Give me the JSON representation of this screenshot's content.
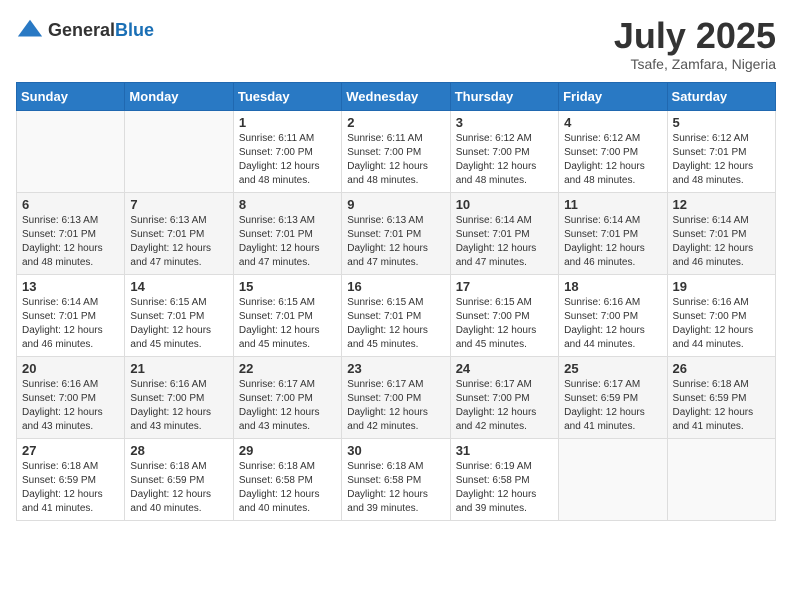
{
  "logo": {
    "general": "General",
    "blue": "Blue"
  },
  "title": {
    "month_year": "July 2025",
    "location": "Tsafe, Zamfara, Nigeria"
  },
  "headers": [
    "Sunday",
    "Monday",
    "Tuesday",
    "Wednesday",
    "Thursday",
    "Friday",
    "Saturday"
  ],
  "weeks": [
    [
      {
        "day": "",
        "sunrise": "",
        "sunset": "",
        "daylight": ""
      },
      {
        "day": "",
        "sunrise": "",
        "sunset": "",
        "daylight": ""
      },
      {
        "day": "1",
        "sunrise": "Sunrise: 6:11 AM",
        "sunset": "Sunset: 7:00 PM",
        "daylight": "Daylight: 12 hours and 48 minutes."
      },
      {
        "day": "2",
        "sunrise": "Sunrise: 6:11 AM",
        "sunset": "Sunset: 7:00 PM",
        "daylight": "Daylight: 12 hours and 48 minutes."
      },
      {
        "day": "3",
        "sunrise": "Sunrise: 6:12 AM",
        "sunset": "Sunset: 7:00 PM",
        "daylight": "Daylight: 12 hours and 48 minutes."
      },
      {
        "day": "4",
        "sunrise": "Sunrise: 6:12 AM",
        "sunset": "Sunset: 7:00 PM",
        "daylight": "Daylight: 12 hours and 48 minutes."
      },
      {
        "day": "5",
        "sunrise": "Sunrise: 6:12 AM",
        "sunset": "Sunset: 7:01 PM",
        "daylight": "Daylight: 12 hours and 48 minutes."
      }
    ],
    [
      {
        "day": "6",
        "sunrise": "Sunrise: 6:13 AM",
        "sunset": "Sunset: 7:01 PM",
        "daylight": "Daylight: 12 hours and 48 minutes."
      },
      {
        "day": "7",
        "sunrise": "Sunrise: 6:13 AM",
        "sunset": "Sunset: 7:01 PM",
        "daylight": "Daylight: 12 hours and 47 minutes."
      },
      {
        "day": "8",
        "sunrise": "Sunrise: 6:13 AM",
        "sunset": "Sunset: 7:01 PM",
        "daylight": "Daylight: 12 hours and 47 minutes."
      },
      {
        "day": "9",
        "sunrise": "Sunrise: 6:13 AM",
        "sunset": "Sunset: 7:01 PM",
        "daylight": "Daylight: 12 hours and 47 minutes."
      },
      {
        "day": "10",
        "sunrise": "Sunrise: 6:14 AM",
        "sunset": "Sunset: 7:01 PM",
        "daylight": "Daylight: 12 hours and 47 minutes."
      },
      {
        "day": "11",
        "sunrise": "Sunrise: 6:14 AM",
        "sunset": "Sunset: 7:01 PM",
        "daylight": "Daylight: 12 hours and 46 minutes."
      },
      {
        "day": "12",
        "sunrise": "Sunrise: 6:14 AM",
        "sunset": "Sunset: 7:01 PM",
        "daylight": "Daylight: 12 hours and 46 minutes."
      }
    ],
    [
      {
        "day": "13",
        "sunrise": "Sunrise: 6:14 AM",
        "sunset": "Sunset: 7:01 PM",
        "daylight": "Daylight: 12 hours and 46 minutes."
      },
      {
        "day": "14",
        "sunrise": "Sunrise: 6:15 AM",
        "sunset": "Sunset: 7:01 PM",
        "daylight": "Daylight: 12 hours and 45 minutes."
      },
      {
        "day": "15",
        "sunrise": "Sunrise: 6:15 AM",
        "sunset": "Sunset: 7:01 PM",
        "daylight": "Daylight: 12 hours and 45 minutes."
      },
      {
        "day": "16",
        "sunrise": "Sunrise: 6:15 AM",
        "sunset": "Sunset: 7:01 PM",
        "daylight": "Daylight: 12 hours and 45 minutes."
      },
      {
        "day": "17",
        "sunrise": "Sunrise: 6:15 AM",
        "sunset": "Sunset: 7:00 PM",
        "daylight": "Daylight: 12 hours and 45 minutes."
      },
      {
        "day": "18",
        "sunrise": "Sunrise: 6:16 AM",
        "sunset": "Sunset: 7:00 PM",
        "daylight": "Daylight: 12 hours and 44 minutes."
      },
      {
        "day": "19",
        "sunrise": "Sunrise: 6:16 AM",
        "sunset": "Sunset: 7:00 PM",
        "daylight": "Daylight: 12 hours and 44 minutes."
      }
    ],
    [
      {
        "day": "20",
        "sunrise": "Sunrise: 6:16 AM",
        "sunset": "Sunset: 7:00 PM",
        "daylight": "Daylight: 12 hours and 43 minutes."
      },
      {
        "day": "21",
        "sunrise": "Sunrise: 6:16 AM",
        "sunset": "Sunset: 7:00 PM",
        "daylight": "Daylight: 12 hours and 43 minutes."
      },
      {
        "day": "22",
        "sunrise": "Sunrise: 6:17 AM",
        "sunset": "Sunset: 7:00 PM",
        "daylight": "Daylight: 12 hours and 43 minutes."
      },
      {
        "day": "23",
        "sunrise": "Sunrise: 6:17 AM",
        "sunset": "Sunset: 7:00 PM",
        "daylight": "Daylight: 12 hours and 42 minutes."
      },
      {
        "day": "24",
        "sunrise": "Sunrise: 6:17 AM",
        "sunset": "Sunset: 7:00 PM",
        "daylight": "Daylight: 12 hours and 42 minutes."
      },
      {
        "day": "25",
        "sunrise": "Sunrise: 6:17 AM",
        "sunset": "Sunset: 6:59 PM",
        "daylight": "Daylight: 12 hours and 41 minutes."
      },
      {
        "day": "26",
        "sunrise": "Sunrise: 6:18 AM",
        "sunset": "Sunset: 6:59 PM",
        "daylight": "Daylight: 12 hours and 41 minutes."
      }
    ],
    [
      {
        "day": "27",
        "sunrise": "Sunrise: 6:18 AM",
        "sunset": "Sunset: 6:59 PM",
        "daylight": "Daylight: 12 hours and 41 minutes."
      },
      {
        "day": "28",
        "sunrise": "Sunrise: 6:18 AM",
        "sunset": "Sunset: 6:59 PM",
        "daylight": "Daylight: 12 hours and 40 minutes."
      },
      {
        "day": "29",
        "sunrise": "Sunrise: 6:18 AM",
        "sunset": "Sunset: 6:58 PM",
        "daylight": "Daylight: 12 hours and 40 minutes."
      },
      {
        "day": "30",
        "sunrise": "Sunrise: 6:18 AM",
        "sunset": "Sunset: 6:58 PM",
        "daylight": "Daylight: 12 hours and 39 minutes."
      },
      {
        "day": "31",
        "sunrise": "Sunrise: 6:19 AM",
        "sunset": "Sunset: 6:58 PM",
        "daylight": "Daylight: 12 hours and 39 minutes."
      },
      {
        "day": "",
        "sunrise": "",
        "sunset": "",
        "daylight": ""
      },
      {
        "day": "",
        "sunrise": "",
        "sunset": "",
        "daylight": ""
      }
    ]
  ]
}
